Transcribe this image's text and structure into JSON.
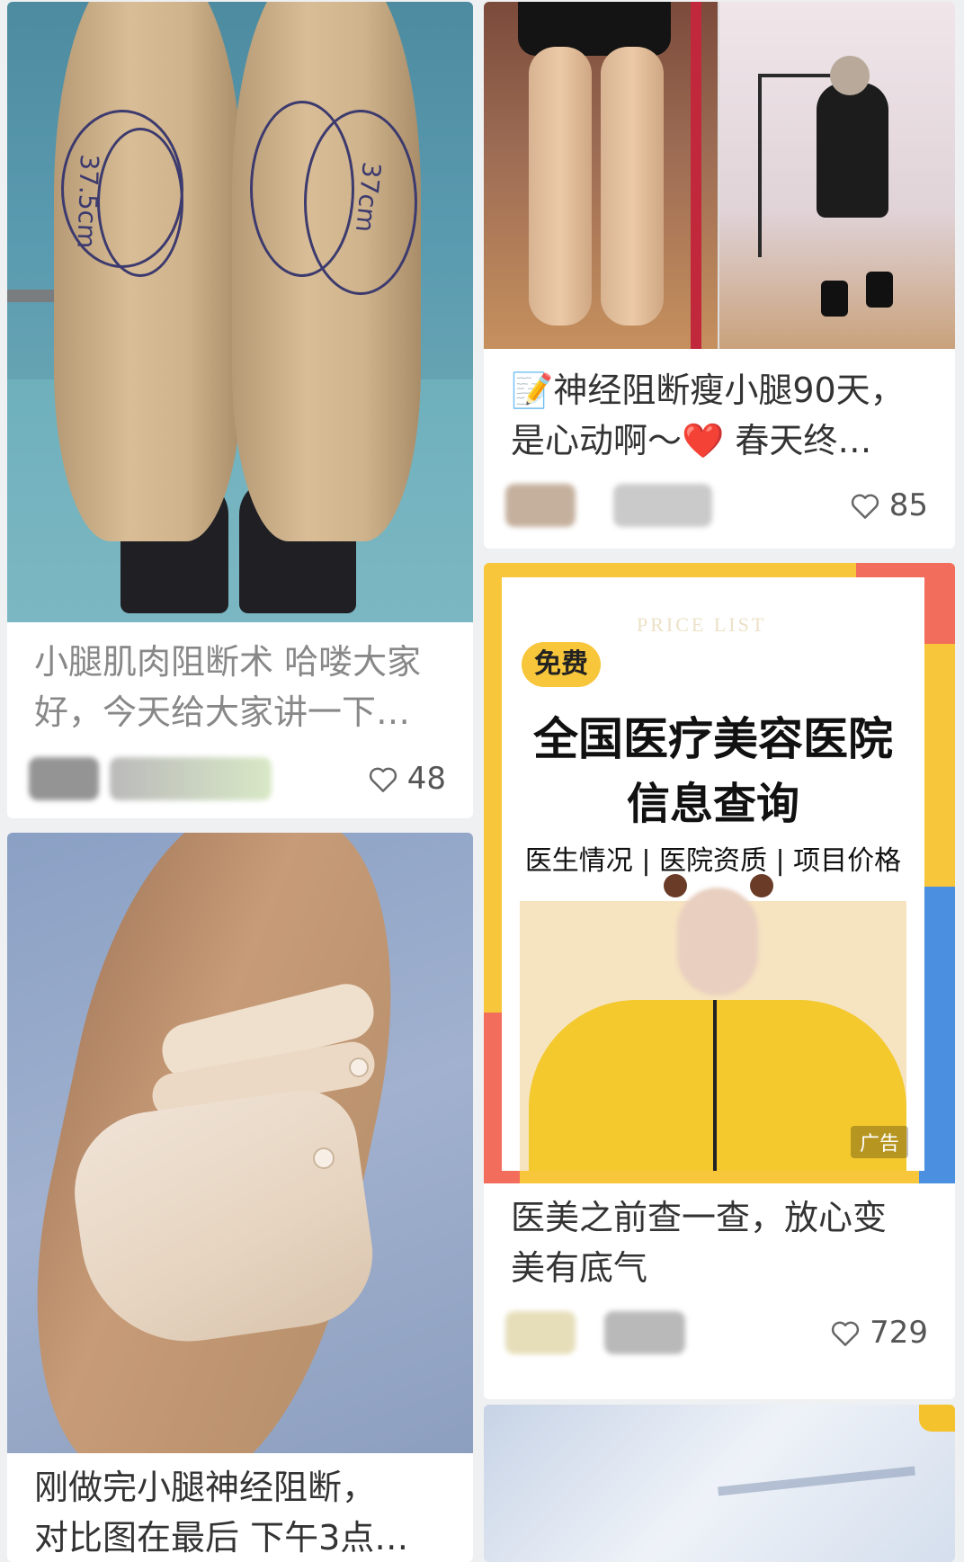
{
  "cards": [
    {
      "title_line1": "小腿肌肉阻断术 哈喽大家",
      "title_line2": "好，今天给大家讲一下…",
      "likes": "48",
      "image_labels": [
        "37.5cm",
        "37cm"
      ]
    },
    {
      "title_line1": "刚做完小腿神经阻断，",
      "title_line2": "对比图在最后 下午3点…"
    },
    {
      "title_line1": "📝神经阻断瘦小腿90天，",
      "title_line2": "是心动啊～❤️ 春天终…",
      "likes": "85"
    },
    {
      "title_line1": "医美之前查一查，放心变",
      "title_line2": "美有底气",
      "likes": "729",
      "ad": {
        "badge": "免费",
        "watermark": "PRICE LIST",
        "headline": "全国医疗美容医院",
        "subheadline": "信息查询",
        "features": "医生情况 | 医院资质 | 项目价格",
        "tag": "广告"
      }
    }
  ],
  "colors": {
    "text": "#333333",
    "likes": "#555555",
    "ad_yellow": "#f7c63b",
    "ad_coral": "#f26d5b",
    "ad_blue": "#4a8fe0"
  },
  "icons": {
    "like": "heart-outline-icon"
  }
}
